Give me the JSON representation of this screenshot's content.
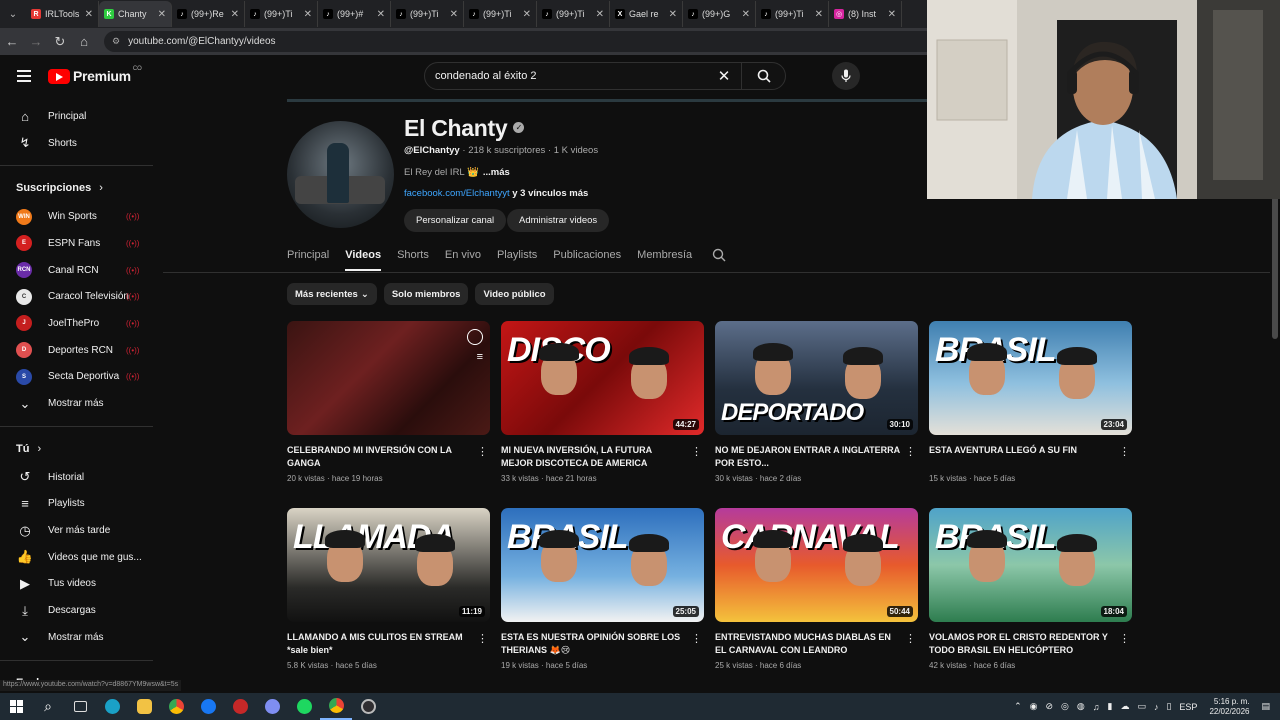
{
  "browser": {
    "tabs": [
      {
        "label": "IRLTools",
        "fav_color": "#e53935",
        "fav_glyph": "R"
      },
      {
        "label": "Chanty",
        "fav_color": "#2ecc40",
        "fav_glyph": "K"
      },
      {
        "label": "(99+)Re",
        "fav_color": "#000000",
        "fav_glyph": "♪"
      },
      {
        "label": "(99+)Ti",
        "fav_color": "#000000",
        "fav_glyph": "♪"
      },
      {
        "label": "(99+)#",
        "fav_color": "#000000",
        "fav_glyph": "♪"
      },
      {
        "label": "(99+)Ti",
        "fav_color": "#000000",
        "fav_glyph": "♪"
      },
      {
        "label": "(99+)Ti",
        "fav_color": "#000000",
        "fav_glyph": "♪"
      },
      {
        "label": "(99+)Ti",
        "fav_color": "#000000",
        "fav_glyph": "♪"
      },
      {
        "label": "Gael re",
        "fav_color": "#000000",
        "fav_glyph": "X"
      },
      {
        "label": "(99+)G",
        "fav_color": "#000000",
        "fav_glyph": "♪"
      },
      {
        "label": "(99+)Ti",
        "fav_color": "#000000",
        "fav_glyph": "♪"
      },
      {
        "label": "(8) Inst",
        "fav_color": "#d6249f",
        "fav_glyph": "◎"
      }
    ],
    "url": "youtube.com/@ElChantyy/videos",
    "status_url": "https://www.youtube.com/watch?v=d8867YM9wsw&t=5s"
  },
  "header": {
    "logo_text": "Premium",
    "country_code": "CO",
    "search_query": "condenado al éxito 2"
  },
  "sidebar": {
    "top": [
      {
        "label": "Principal",
        "icon": "home-icon",
        "glyph": "⌂"
      },
      {
        "label": "Shorts",
        "icon": "shorts-icon",
        "glyph": "↯"
      }
    ],
    "subscriptions_title": "Suscripciones",
    "subscriptions": [
      {
        "label": "Win Sports",
        "color": "#f07a1a",
        "initials": "WIN"
      },
      {
        "label": "ESPN Fans",
        "color": "#d42020",
        "initials": "E"
      },
      {
        "label": "Canal RCN",
        "color": "#6a2ca8",
        "initials": "RCN"
      },
      {
        "label": "Caracol Televisión",
        "color": "#e8e8e8",
        "initials": "C"
      },
      {
        "label": "JoelThePro",
        "color": "#c41e1e",
        "initials": "J"
      },
      {
        "label": "Deportes RCN",
        "color": "#e05050",
        "initials": "D"
      },
      {
        "label": "Secta Deportiva",
        "color": "#2a4aa8",
        "initials": "S"
      }
    ],
    "subscriptions_more": "Mostrar más",
    "you_title": "Tú",
    "you_items": [
      {
        "label": "Historial",
        "icon": "history-icon",
        "glyph": "↺"
      },
      {
        "label": "Playlists",
        "icon": "playlists-icon",
        "glyph": "≡"
      },
      {
        "label": "Ver más tarde",
        "icon": "clock-icon",
        "glyph": "◷"
      },
      {
        "label": "Videos que me gus...",
        "icon": "thumbs-up-icon",
        "glyph": "👍"
      },
      {
        "label": "Tus videos",
        "icon": "your-videos-icon",
        "glyph": "▶"
      },
      {
        "label": "Descargas",
        "icon": "download-icon",
        "glyph": "⤓"
      }
    ],
    "you_more": "Mostrar más",
    "explore_title": "Explorar"
  },
  "channel": {
    "name": "El Chanty",
    "handle": "@ElChantyy",
    "subscribers": "218 k suscriptores",
    "videos_count": "1 K videos",
    "description": "El Rey del IRL 👑",
    "more_label": "...más",
    "link": "facebook.com/Elchantyyt",
    "more_links": "y 3 vínculos más",
    "customize_label": "Personalizar canal",
    "manage_label": "Administrar videos",
    "tabs": [
      "Principal",
      "Videos",
      "Shorts",
      "En vivo",
      "Playlists",
      "Publicaciones",
      "Membresía"
    ],
    "active_tab": "Videos"
  },
  "filters": [
    "Más recientes",
    "Solo miembros",
    "Video público"
  ],
  "videos": [
    {
      "title": "CELEBRANDO MI INVERSIÓN CON LA GANGA",
      "views": "20 k vistas",
      "age": "hace 19 horas",
      "duration": ""
    },
    {
      "title": "MI NUEVA INVERSIÓN, LA FUTURA MEJOR DISCOTECA DE AMERICA",
      "views": "33 k vistas",
      "age": "hace 21 horas",
      "duration": "44:27"
    },
    {
      "title": "NO ME DEJARON ENTRAR A INGLATERRA POR ESTO...",
      "views": "30 k vistas",
      "age": "hace 2 días",
      "duration": "30:10"
    },
    {
      "title": "ESTA AVENTURA LLEGÓ A SU FIN",
      "views": "15 k vistas",
      "age": "hace 5 días",
      "duration": "23:04"
    },
    {
      "title": "LLAMANDO A MIS CULITOS EN STREAM *sale bien*",
      "views": "5.8 K vistas",
      "age": "hace 5 días",
      "duration": "11:19"
    },
    {
      "title": "ESTA ES NUESTRA OPINIÓN SOBRE LOS THERIANS 🦊😢",
      "views": "19 k vistas",
      "age": "hace 5 días",
      "duration": "25:05"
    },
    {
      "title": "ENTREVISTANDO MUCHAS DIABLAS EN EL CARNAVAL CON LEANDRO",
      "views": "25 k vistas",
      "age": "hace 6 días",
      "duration": "50:44"
    },
    {
      "title": "VOLAMOS POR EL CRISTO REDENTOR Y TODO BRASIL EN HELICÓPTERO",
      "views": "42 k vistas",
      "age": "hace 6 días",
      "duration": "18:04"
    }
  ],
  "thumb_text": [
    "",
    "DISCO",
    "DEPORTADO",
    "BRASIL",
    "LLAMADA",
    "BRASIL",
    "CARNAVAL",
    "BRASIL"
  ],
  "taskbar": {
    "lang": "ESP",
    "time": "5:16 p. m.",
    "date": "22/02/2026"
  }
}
